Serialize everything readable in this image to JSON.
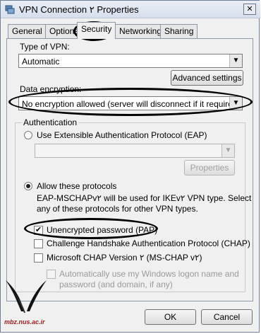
{
  "window": {
    "title": "VPN Connection ۲ Properties",
    "close_glyph": "✕"
  },
  "tabs": [
    {
      "label": "General"
    },
    {
      "label": "Options"
    },
    {
      "label": "Security"
    },
    {
      "label": "Networking"
    },
    {
      "label": "Sharing"
    }
  ],
  "vpn_type": {
    "label": "Type of VPN:",
    "value": "Automatic"
  },
  "advanced_settings": "Advanced settings",
  "encryption": {
    "label": "Data encryption:",
    "value": "No encryption allowed (server will disconnect if it requires encry"
  },
  "auth": {
    "legend": "Authentication",
    "eap_label": "Use Extensible Authentication Protocol (EAP)",
    "eap_value": "",
    "properties_label": "Properties",
    "allow_label": "Allow these protocols",
    "note_line1": "EAP-MSCHAPv۲ will be used for IKEv۲ VPN type. Select",
    "note_line2": "any of these protocols for other VPN types.",
    "pap_label": "Unencrypted password (PAP)",
    "pap_checked": true,
    "chap_label": "Challenge Handshake Authentication Protocol (CHAP)",
    "mschap_label": "Microsoft CHAP Version ۲ (MS-CHAP v۲)",
    "auto_line1": "Automatically use my Windows logon name and",
    "auto_line2": "password (and domain, if any)"
  },
  "buttons": {
    "ok": "OK",
    "cancel": "Cancel"
  },
  "watermark": {
    "text": "mbz.nus.ac.ir"
  }
}
